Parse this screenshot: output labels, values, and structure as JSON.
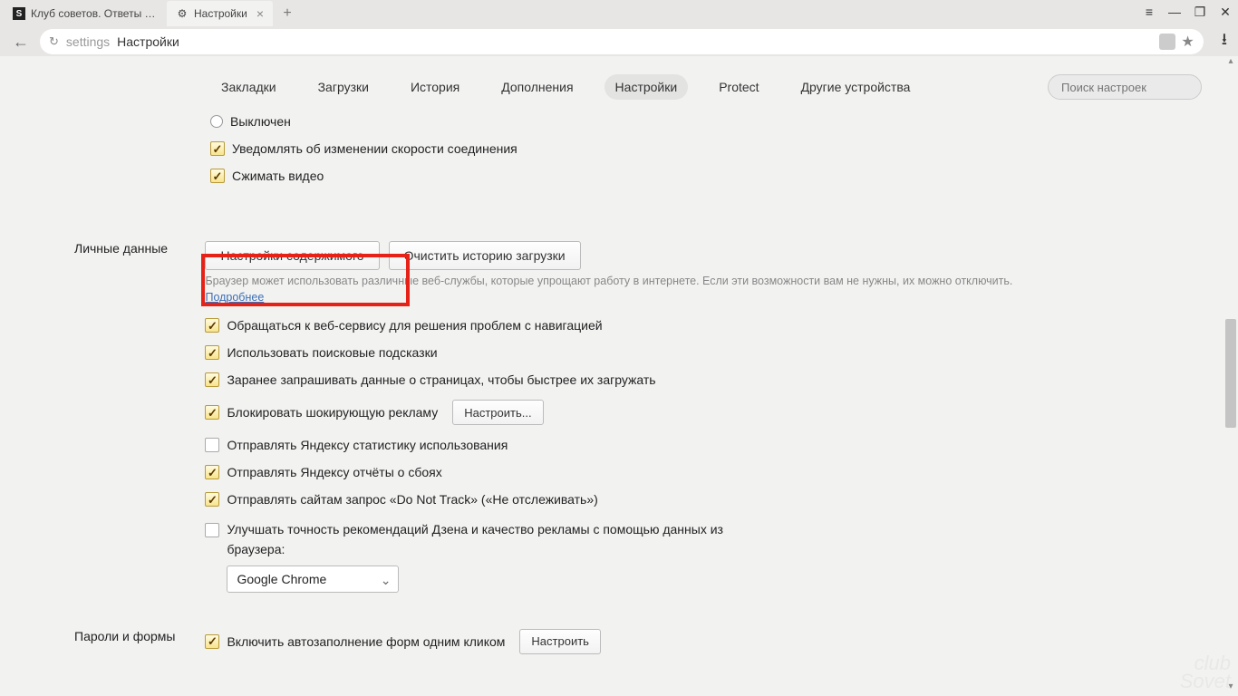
{
  "tabs": [
    {
      "title": "Клуб советов. Ответы на вс",
      "favicon": "S"
    },
    {
      "title": "Настройки",
      "favicon": "gear"
    }
  ],
  "omnibox": {
    "prefix": "settings",
    "main": "Настройки"
  },
  "toolbar": {
    "items": [
      "Закладки",
      "Загрузки",
      "История",
      "Дополнения",
      "Настройки",
      "Protect",
      "Другие устройства"
    ],
    "active_index": 4,
    "search_placeholder": "Поиск настроек"
  },
  "turbo_section": {
    "radio_off": "Выключен",
    "notify_speed": "Уведомлять об изменении скорости соединения",
    "compress_video": "Сжимать видео"
  },
  "personal": {
    "label": "Личные данные",
    "btn_content": "Настройки содержимого",
    "btn_clear": "Очистить историю загрузки",
    "hint": "Браузер может использовать различные веб-службы, которые упрощают работу в интернете. Если эти возможности вам не нужны, их можно отключить. ",
    "hint_link": "Подробнее",
    "opts": {
      "nav_webservice": "Обращаться к веб-сервису для решения проблем с навигацией",
      "search_hints": "Использовать поисковые подсказки",
      "prefetch": "Заранее запрашивать данные о страницах, чтобы быстрее их загружать",
      "block_shocking": "Блокировать шокирующую рекламу",
      "block_shocking_btn": "Настроить...",
      "send_stats": "Отправлять Яндексу статистику использования",
      "send_crash": "Отправлять Яндексу отчёты о сбоях",
      "dnt": "Отправлять сайтам запрос «Do Not Track» («Не отслеживать»)",
      "zen_accuracy": "Улучшать точность рекомендаций Дзена и качество рекламы с помощью данных из браузера:",
      "browser_select": "Google Chrome"
    }
  },
  "passwords": {
    "label": "Пароли и формы",
    "autofill": "Включить автозаполнение форм одним кликом",
    "autofill_btn": "Настроить"
  },
  "watermark": {
    "line1": "club",
    "line2": "Sovet"
  }
}
